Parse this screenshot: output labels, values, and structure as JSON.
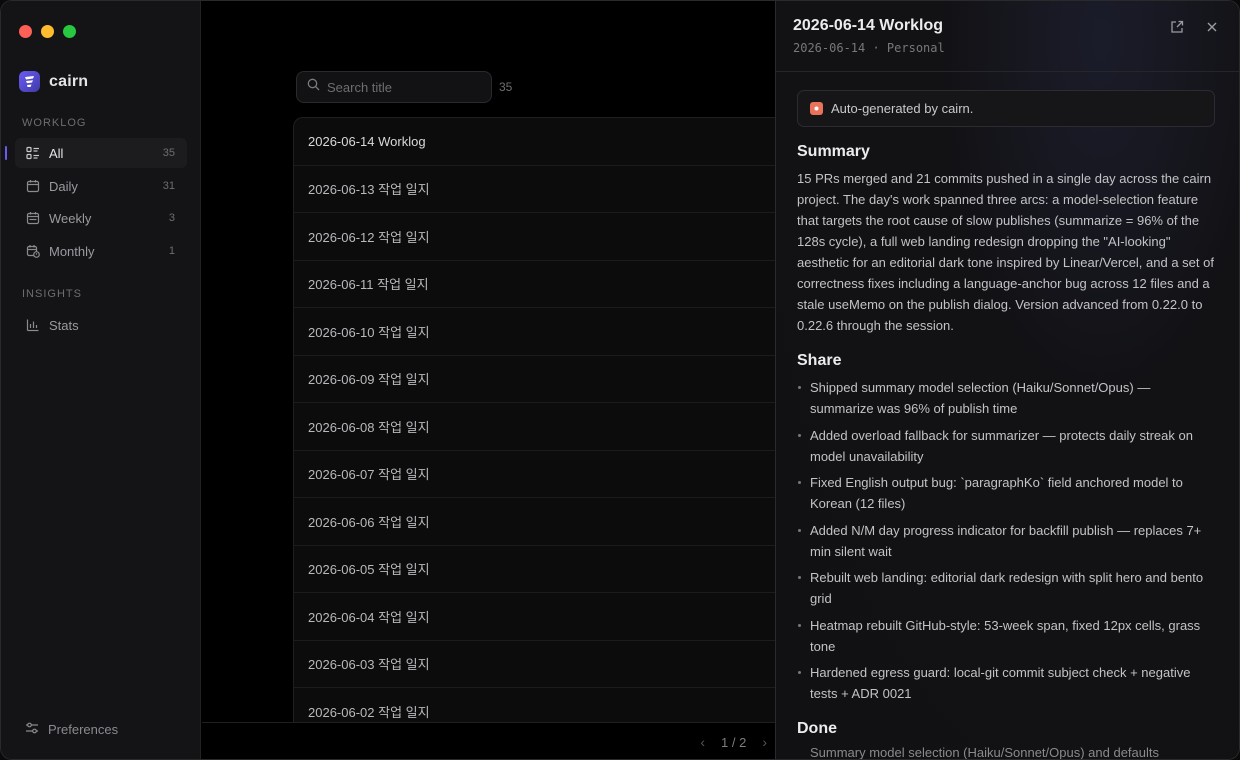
{
  "sidebar": {
    "app_name": "cairn",
    "sections": {
      "worklog": "WORKLOG",
      "insights": "INSIGHTS"
    },
    "items": [
      {
        "label": "All",
        "count": "35"
      },
      {
        "label": "Daily",
        "count": "31"
      },
      {
        "label": "Weekly",
        "count": "3"
      },
      {
        "label": "Monthly",
        "count": "1"
      }
    ],
    "insights_items": [
      {
        "label": "Stats"
      }
    ],
    "preferences_label": "Preferences"
  },
  "list": {
    "search_placeholder": "Search title",
    "count": "35",
    "rows": [
      "2026-06-14 Worklog",
      "2026-06-13 작업 일지",
      "2026-06-12 작업 일지",
      "2026-06-11 작업 일지",
      "2026-06-10 작업 일지",
      "2026-06-09 작업 일지",
      "2026-06-08 작업 일지",
      "2026-06-07 작업 일지",
      "2026-06-06 작업 일지",
      "2026-06-05 작업 일지",
      "2026-06-04 작업 일지",
      "2026-06-03 작업 일지",
      "2026-06-02 작업 일지"
    ],
    "pager": {
      "page": "1 / 2"
    }
  },
  "detail": {
    "title": "2026-06-14 Worklog",
    "subtitle": "2026-06-14 · Personal",
    "notice": "Auto-generated by cairn.",
    "summary_heading": "Summary",
    "summary_text": "15 PRs merged and 21 commits pushed in a single day across the cairn project. The day's work spanned three arcs: a model-selection feature that targets the root cause of slow publishes (summarize = 96% of the 128s cycle), a full web landing redesign dropping the \"AI-looking\" aesthetic for an editorial dark tone inspired by Linear/Vercel, and a set of correctness fixes including a language-anchor bug across 12 files and a stale useMemo on the publish dialog. Version advanced from 0.22.0 to 0.22.6 through the session.",
    "share_heading": "Share",
    "share_items": [
      "Shipped summary model selection (Haiku/Sonnet/Opus) — summarize was 96% of publish time",
      "Added overload fallback for summarizer — protects daily streak on model unavailability",
      "Fixed English output bug: `paragraphKo` field anchored model to Korean (12 files)",
      "Added N/M day progress indicator for backfill publish — replaces 7+ min silent wait",
      "Rebuilt web landing: editorial dark redesign with split hero and bento grid",
      "Heatmap rebuilt GitHub-style: 53-week span, fixed 12px cells, grass tone",
      "Hardened egress guard: local-git commit subject check + negative tests + ADR 0021"
    ],
    "done_heading": "Done",
    "done_partial": "Summary model selection (Haiku/Sonnet/Opus) and defaults"
  },
  "colors": {
    "accent": "#6a5cf2",
    "notice_icon": "#e8735a",
    "traffic_red": "#fe5f57",
    "traffic_yellow": "#febc2e",
    "traffic_green": "#28c840"
  }
}
